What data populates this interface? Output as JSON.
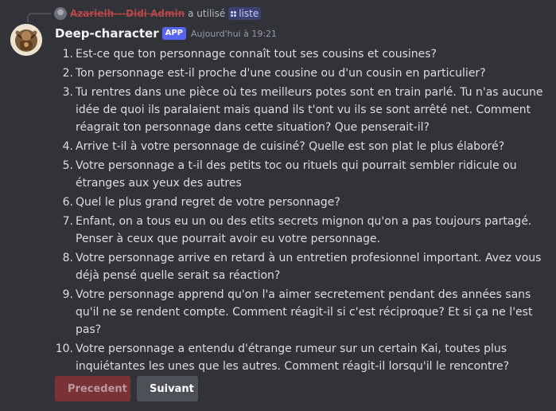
{
  "reply": {
    "user": "Azarielh---Didi Admin",
    "used_text": "a utilisé",
    "command": "liste"
  },
  "message": {
    "author": "Deep-character",
    "badge": "APP",
    "timestamp": "Aujourd'hui à 19:21"
  },
  "questions": [
    {
      "num": "1.",
      "text": "Est-ce que ton personnage connaît tout ses cousins et cousines?"
    },
    {
      "num": "2.",
      "text": "Ton personnage est-il proche d'une cousine ou d'un cousin en particulier?"
    },
    {
      "num": "3.",
      "text": "Tu rentres dans une pièce où tes meilleurs potes sont en train parlé. Tu n'as aucune idée de quoi ils paralaient mais quand ils t'ont vu ils se sont arrêté net. Comment réagrait ton personnage dans cette situation? Que penserait-il?"
    },
    {
      "num": "4.",
      "text": "Arrive t-il à votre personnage de cuisiné? Quelle est son plat le plus élaboré?"
    },
    {
      "num": "5.",
      "text": "Votre personnage a t-il des petits toc ou rituels qui pourrait sembler ridicule ou étranges aux yeux des autres"
    },
    {
      "num": "6.",
      "text": "Quel le plus grand regret de votre personnage?"
    },
    {
      "num": "7.",
      "text": "Enfant, on a tous eu un ou des etits secrets mignon qu'on a pas toujours partagé. Penser à ceux que pourrait avoir eu votre personnage."
    },
    {
      "num": "8.",
      "text": "Votre personnage arrive en retard à un entretien profesionnel important. Avez vous déjà pensé quelle serait sa réaction?"
    },
    {
      "num": "9.",
      "text": "Votre personnage apprend qu'on l'a aimer secretement pendant des années sans qu'il ne se rendent compte. Comment réagit-il si c'est réciproque? Et si ça ne l'est pas?"
    },
    {
      "num": "10.",
      "text": "Votre personnage a entendu d'étrange rumeur sur un certain Kai, toutes plus inquiétantes les unes que les autres. Comment réagit-il lorsqu'il le rencontre?"
    }
  ],
  "buttons": {
    "previous": "Precedent",
    "next": "Suivant"
  }
}
